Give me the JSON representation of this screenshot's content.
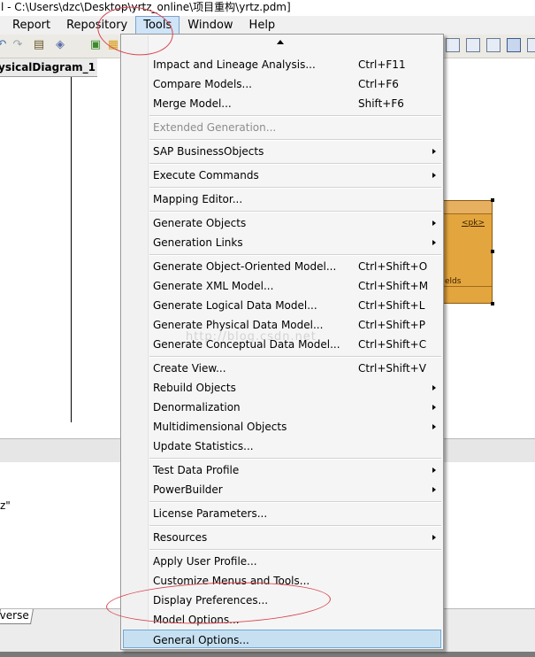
{
  "window": {
    "title": "l - C:\\Users\\dzc\\Desktop\\yrtz_online\\项目重构\\yrtz.pdm]"
  },
  "menubar": {
    "items": [
      {
        "label": "Report"
      },
      {
        "label": "Repository"
      },
      {
        "label": "Tools"
      },
      {
        "label": "Window"
      },
      {
        "label": "Help"
      }
    ]
  },
  "diagram": {
    "tab_label": "ysicalDiagram_1",
    "entity_pk": "<pk>",
    "entity_fields_fragment": "elds"
  },
  "output": {
    "line_fragment": "z\""
  },
  "bottom": {
    "tab_label": "verse"
  },
  "watermark": "http://blog.csdn.net",
  "tools_menu": {
    "items": [
      {
        "label": "Impact and Lineage Analysis...",
        "shortcut": "Ctrl+F11"
      },
      {
        "label": "Compare Models...",
        "shortcut": "Ctrl+F6"
      },
      {
        "label": "Merge Model...",
        "shortcut": "Shift+F6"
      },
      {
        "label": "Extended Generation...",
        "disabled": true
      },
      {
        "label": "SAP BusinessObjects",
        "submenu": true
      },
      {
        "label": "Execute Commands",
        "submenu": true
      },
      {
        "label": "Mapping Editor..."
      },
      {
        "label": "Generate Objects",
        "submenu": true
      },
      {
        "label": "Generation Links",
        "submenu": true
      },
      {
        "label": "Generate Object-Oriented Model...",
        "shortcut": "Ctrl+Shift+O"
      },
      {
        "label": "Generate XML Model...",
        "shortcut": "Ctrl+Shift+M"
      },
      {
        "label": "Generate Logical Data Model...",
        "shortcut": "Ctrl+Shift+L"
      },
      {
        "label": "Generate Physical Data Model...",
        "shortcut": "Ctrl+Shift+P"
      },
      {
        "label": "Generate Conceptual Data Model...",
        "shortcut": "Ctrl+Shift+C"
      },
      {
        "label": "Create View...",
        "shortcut": "Ctrl+Shift+V"
      },
      {
        "label": "Rebuild Objects",
        "submenu": true
      },
      {
        "label": "Denormalization",
        "submenu": true
      },
      {
        "label": "Multidimensional Objects",
        "submenu": true
      },
      {
        "label": "Update Statistics..."
      },
      {
        "label": "Test Data Profile",
        "submenu": true
      },
      {
        "label": "PowerBuilder",
        "submenu": true
      },
      {
        "label": "License Parameters..."
      },
      {
        "label": "Resources",
        "submenu": true
      },
      {
        "label": "Apply User Profile..."
      },
      {
        "label": "Customize Menus and Tools..."
      },
      {
        "label": "Display Preferences..."
      },
      {
        "label": "Model Options..."
      },
      {
        "label": "General Options...",
        "highlighted": true
      }
    ]
  },
  "colors": {
    "menu_highlight": "#c6e0f1",
    "menubar_active": "#cfe4f7",
    "annotation": "#d9454f",
    "entity_fill": "#e3a53d"
  }
}
